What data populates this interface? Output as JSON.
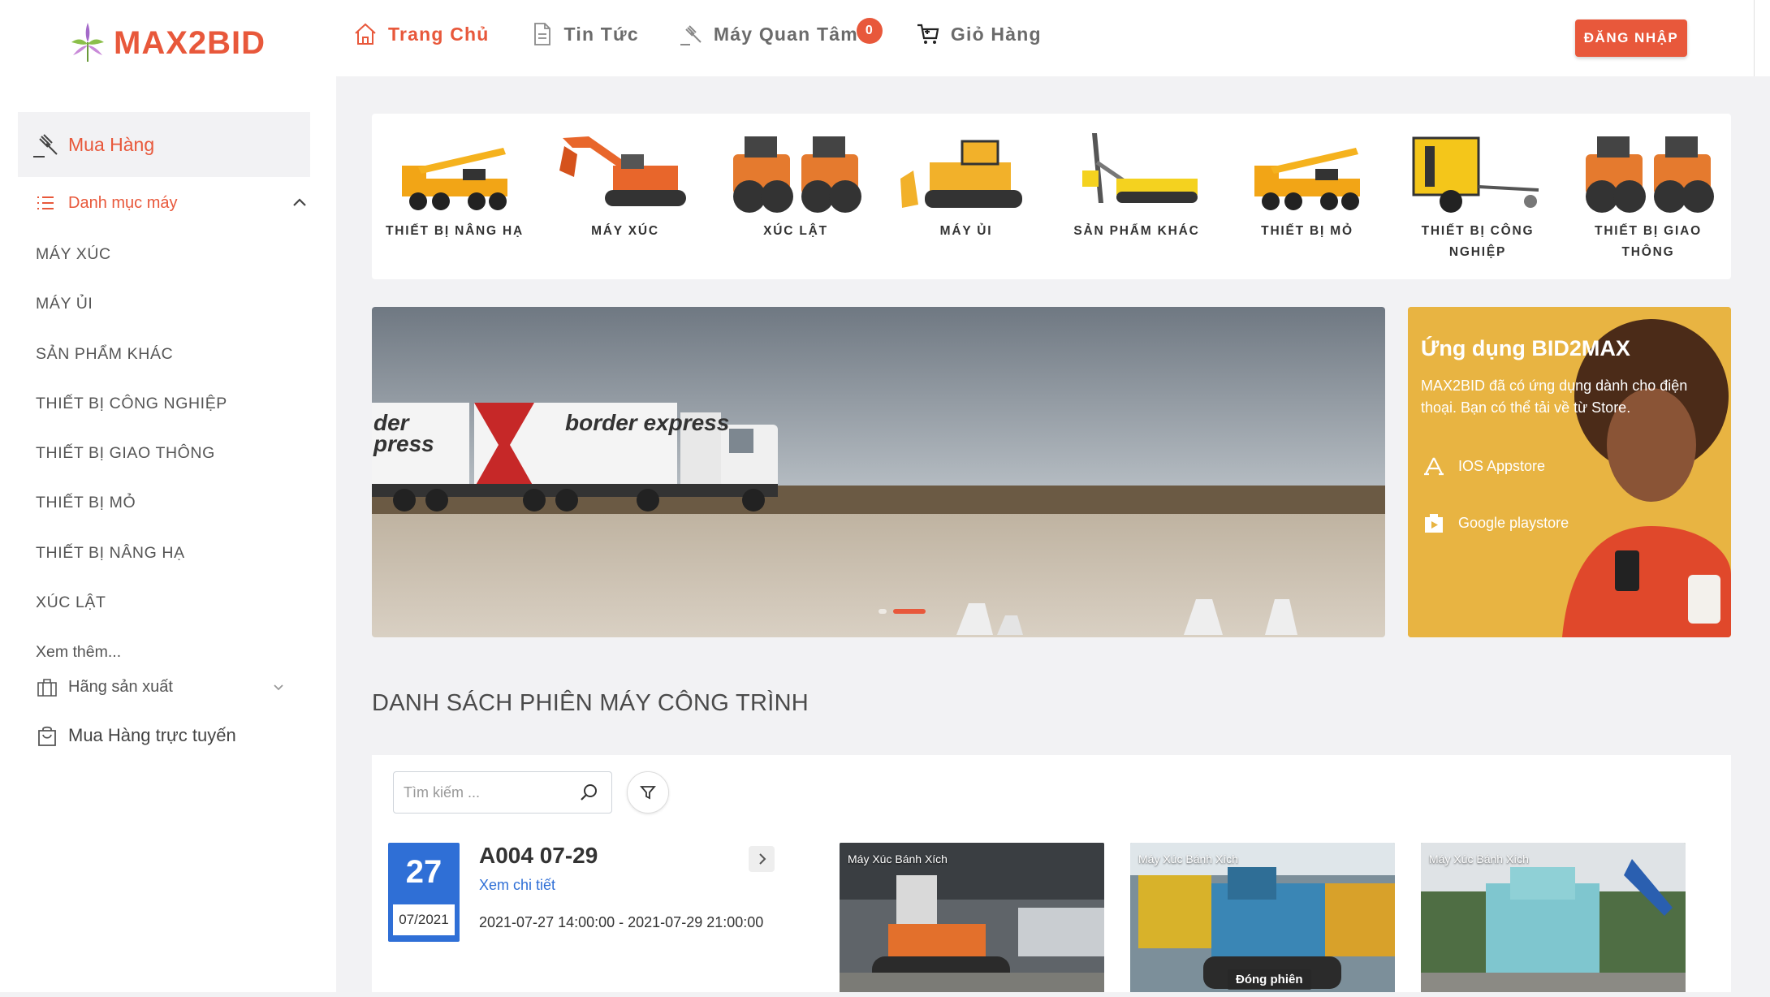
{
  "brand": {
    "name": "MAX2BID",
    "color": "#e8583b"
  },
  "nav": {
    "items": [
      {
        "label": "Trang Chủ",
        "icon": "home-icon",
        "active": true
      },
      {
        "label": "Tin Tức",
        "icon": "document-icon"
      },
      {
        "label": "Máy Quan Tâm",
        "icon": "gavel-icon",
        "badge": "0"
      },
      {
        "label": "Giỏ Hàng",
        "icon": "cart-icon"
      }
    ],
    "login_label": "ĐĂNG NHẬP"
  },
  "sidebar": {
    "heading": "Mua Hàng",
    "category_title": "Danh mục máy",
    "categories": [
      "MÁY XÚC",
      "MÁY ỦI",
      "SẢN PHẨM KHÁC",
      "THIẾT BỊ CÔNG NGHIỆP",
      "THIẾT BỊ GIAO THÔNG",
      "THIẾT BỊ MỎ",
      "THIẾT BỊ NÂNG HẠ",
      "XÚC LẬT"
    ],
    "see_more": "Xem thêm...",
    "manufacturer": "Hãng sản xuất",
    "online": "Mua Hàng trực tuyến"
  },
  "category_strip": [
    {
      "label": "THIẾT BỊ NÂNG HẠ",
      "icon": "crane-truck-icon"
    },
    {
      "label": "MÁY XÚC",
      "icon": "excavator-icon"
    },
    {
      "label": "XÚC LẬT",
      "icon": "roller-icon"
    },
    {
      "label": "MÁY ỦI",
      "icon": "bulldozer-icon"
    },
    {
      "label": "SẢN PHẨM KHÁC",
      "icon": "drill-rig-icon"
    },
    {
      "label": "THIẾT BỊ MỎ",
      "icon": "crane-truck-icon"
    },
    {
      "label": "THIẾT BỊ CÔNG NGHIỆP",
      "icon": "generator-trailer-icon"
    },
    {
      "label": "THIẾT BỊ GIAO THÔNG",
      "icon": "roller-icon"
    }
  ],
  "banner": {
    "truck_text_1": "border express",
    "truck_text_2": "der press",
    "slides": 2,
    "active_slide": 2
  },
  "promo": {
    "title": "Ứng dụng BID2MAX",
    "description": "MAX2BID đã có ứng dụng dành cho điện thoại. Bạn có thể tải về từ Store.",
    "ios_label": "IOS Appstore",
    "android_label": "Google playstore"
  },
  "auctions": {
    "section_title": "DANH SÁCH PHIÊN MÁY CÔNG TRÌNH",
    "search_placeholder": "Tìm kiếm ...",
    "session": {
      "day": "27",
      "month_year": "07/2021",
      "code": "A004 07-29",
      "detail_link": "Xem chi tiết",
      "time_range": "2021-07-27 14:00:00 - 2021-07-29 21:00:00"
    },
    "thumbnails": [
      {
        "caption": "Máy Xúc Bánh Xích",
        "tag": ""
      },
      {
        "caption": "Máy Xúc Bánh Xích",
        "tag": "Đóng phiên"
      },
      {
        "caption": "Máy Xúc Bánh Xích",
        "tag": ""
      }
    ]
  }
}
